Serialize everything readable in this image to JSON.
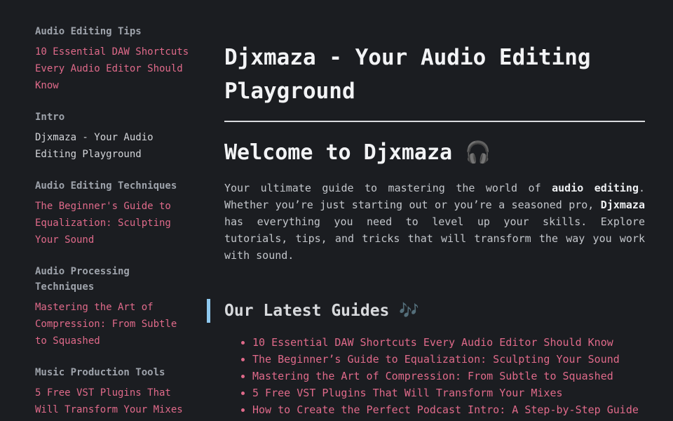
{
  "sidebar": {
    "sections": [
      {
        "heading": "Audio Editing Tips",
        "link": "10 Essential DAW Shortcuts Every Audio Editor Should Know"
      },
      {
        "heading": "Intro",
        "link": "Djxmaza - Your Audio Editing Playground"
      },
      {
        "heading": "Audio Editing Techniques",
        "link": "The Beginner's Guide to Equalization: Sculpting Your Sound"
      },
      {
        "heading": "Audio Processing Techniques",
        "link": "Mastering the Art of Compression: From Subtle to Squashed"
      },
      {
        "heading": "Music Production Tools",
        "link": "5 Free VST Plugins That Will Transform Your Mixes"
      }
    ]
  },
  "main": {
    "title": "Djxmaza - Your Audio Editing Playground",
    "welcome": "Welcome to Djxmaza",
    "welcome_emoji": "🎧",
    "intro": {
      "part1": "Your ultimate guide to mastering the world of ",
      "bold1": "audio editing",
      "part2": ". Whether you’re just starting out or you’re a seasoned pro, ",
      "bold2": "Djxmaza",
      "part3": " has everything you need to level up your skills. Explore tutorials, tips, and tricks that will transform the way you work with sound."
    },
    "guides_heading": "Our Latest Guides",
    "guides_emoji": "🎶",
    "guides": [
      "10 Essential DAW Shortcuts Every Audio Editor Should Know",
      "The Beginner’s Guide to Equalization: Sculpting Your Sound",
      "Mastering the Art of Compression: From Subtle to Squashed",
      "5 Free VST Plugins That Will Transform Your Mixes",
      "How to Create the Perfect Podcast Intro: A Step-by-Step Guide"
    ]
  },
  "colors": {
    "background": "#1b1d21",
    "link": "#e06a8a",
    "accent_bar": "#8fc9ef"
  }
}
